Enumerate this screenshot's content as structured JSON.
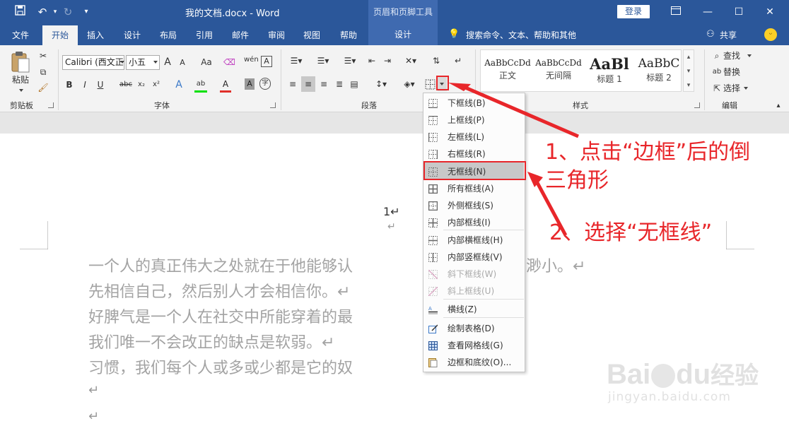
{
  "titlebar": {
    "doc_title": "我的文档.docx  -  Word",
    "context_label": "页眉和页脚工具",
    "login": "登录",
    "icons": [
      "save-icon",
      "undo-icon",
      "redo-icon",
      "customize-qat-icon"
    ],
    "window_controls": [
      "ribbon-display-icon",
      "minimize-icon",
      "maximize-icon",
      "close-icon"
    ]
  },
  "tabs": [
    {
      "label": "文件"
    },
    {
      "label": "开始"
    },
    {
      "label": "插入"
    },
    {
      "label": "设计"
    },
    {
      "label": "布局"
    },
    {
      "label": "引用"
    },
    {
      "label": "邮件"
    },
    {
      "label": "审阅"
    },
    {
      "label": "视图"
    },
    {
      "label": "帮助"
    }
  ],
  "context_tab": "设计",
  "search_hint": "搜索命令、文本、帮助和其他",
  "share": "共享",
  "clipboard": {
    "paste": "粘贴",
    "label": "剪贴板"
  },
  "font": {
    "name": "Calibri (西文正文)",
    "size": "小五",
    "label": "字体",
    "buttons": {
      "bold": "B",
      "italic": "I",
      "underline": "U",
      "strike": "abc",
      "sub": "x₂",
      "sup": "x²",
      "grow": "A",
      "shrink": "A",
      "case": "Aa"
    }
  },
  "paragraph": {
    "label": "段落"
  },
  "styles": {
    "label": "样式",
    "items": [
      {
        "sample": "AaBbCcDd",
        "name": "正文"
      },
      {
        "sample": "AaBbCcDd",
        "name": "无间隔"
      },
      {
        "sample": "AaBl",
        "name": "标题 1"
      },
      {
        "sample": "AaBbC",
        "name": "标题 2"
      }
    ]
  },
  "editing": {
    "label": "编辑",
    "find": "查找",
    "replace": "替换",
    "select": "选择"
  },
  "document": {
    "page_number": "1↵",
    "lines": [
      "一个人的真正伟大之处就在于他能够认",
      "先相信自己，然后别人才会相信你。↵",
      "好脾气是一个人在社交中所能穿着的最",
      "我们唯一不会改正的缺点是软弱。↵",
      "习惯，我们每个人或多或少都是它的奴"
    ],
    "line1_tail": "渺小。↵",
    "para_mark": "↵"
  },
  "border_menu": {
    "items": [
      {
        "label": "下框线(B)",
        "icon": "border-bottom-icon",
        "disabled": false
      },
      {
        "label": "上框线(P)",
        "icon": "border-top-icon",
        "disabled": false
      },
      {
        "label": "左框线(L)",
        "icon": "border-left-icon",
        "disabled": false
      },
      {
        "label": "右框线(R)",
        "icon": "border-right-icon",
        "disabled": false
      },
      {
        "label": "无框线(N)",
        "icon": "no-border-icon",
        "disabled": false,
        "highlighted": true
      },
      {
        "label": "所有框线(A)",
        "icon": "all-borders-icon",
        "disabled": false
      },
      {
        "label": "外侧框线(S)",
        "icon": "outside-borders-icon",
        "disabled": false
      },
      {
        "label": "内部框线(I)",
        "icon": "inside-borders-icon",
        "disabled": false
      },
      {
        "label": "内部横框线(H)",
        "icon": "inside-horizontal-border-icon",
        "disabled": false
      },
      {
        "label": "内部竖框线(V)",
        "icon": "inside-vertical-border-icon",
        "disabled": false
      },
      {
        "label": "斜下框线(W)",
        "icon": "diagonal-down-border-icon",
        "disabled": true
      },
      {
        "label": "斜上框线(U)",
        "icon": "diagonal-up-border-icon",
        "disabled": true
      },
      {
        "label": "横线(Z)",
        "icon": "horizontal-line-icon",
        "disabled": false
      },
      {
        "label": "绘制表格(D)",
        "icon": "draw-table-icon",
        "disabled": false
      },
      {
        "label": "查看网格线(G)",
        "icon": "view-gridlines-icon",
        "disabled": false
      },
      {
        "label": "边框和底纹(O)...",
        "icon": "borders-shading-icon",
        "disabled": false
      }
    ]
  },
  "annotations": {
    "step1_line1": "1、点击“边框”后的倒",
    "step1_line2": "三角形",
    "step2": "2、选择“无框线”"
  },
  "watermark": {
    "brand": "Bai",
    "brand2": "du",
    "brand_cn": "经验",
    "url": "jingyan.baidu.com"
  },
  "colors": {
    "word_blue": "#2b579a",
    "context_blue": "#3f6ab0",
    "annotation_red": "#e8262a",
    "highlight_green": "#00e000",
    "font_red": "#e0302a"
  }
}
